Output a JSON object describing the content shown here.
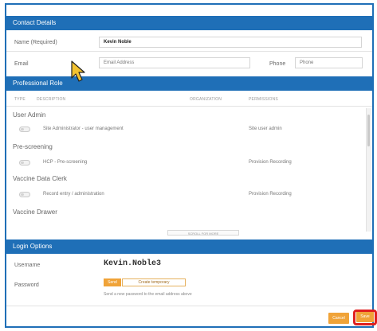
{
  "contact": {
    "header": "Contact Details",
    "name_label": "Name (Required)",
    "name_value": "Kevin Noble",
    "email_label": "Email",
    "email_placeholder": "Email Address",
    "phone_label": "Phone",
    "phone_placeholder": "Phone"
  },
  "role": {
    "header": "Professional Role",
    "columns": {
      "type": "TYPE",
      "description": "DESCRIPTION",
      "organization": "ORGANIZATION",
      "permissions": "PERMISSIONS"
    },
    "groups": [
      {
        "name": "User Admin",
        "item": {
          "description": "Site Administrator - user management",
          "permission": "Site user admin"
        }
      },
      {
        "name": "Pre-screening",
        "item": {
          "description": "HCP - Pre-screening",
          "permission": "Provision Recording"
        }
      },
      {
        "name": "Vaccine Data Clerk",
        "item": {
          "description": "Record entry / administration",
          "permission": "Provision Recording"
        }
      },
      {
        "name": "Vaccine Drawer",
        "item": null
      }
    ],
    "scroll_more_label": "SCROLL FOR MORE"
  },
  "login": {
    "header": "Login Options",
    "username_label": "Username",
    "username_value": "Kevin.Noble3",
    "password_label": "Password",
    "send_button": "Send",
    "custom_button": "Create temporary",
    "hint": "Send a new password to the email address above"
  },
  "footer": {
    "cancel_label": "Cancel",
    "save_label": "Save"
  },
  "colors": {
    "section_header": "#1f6fb7",
    "accent_orange": "#f0a338",
    "highlight_red": "#e0201f"
  }
}
